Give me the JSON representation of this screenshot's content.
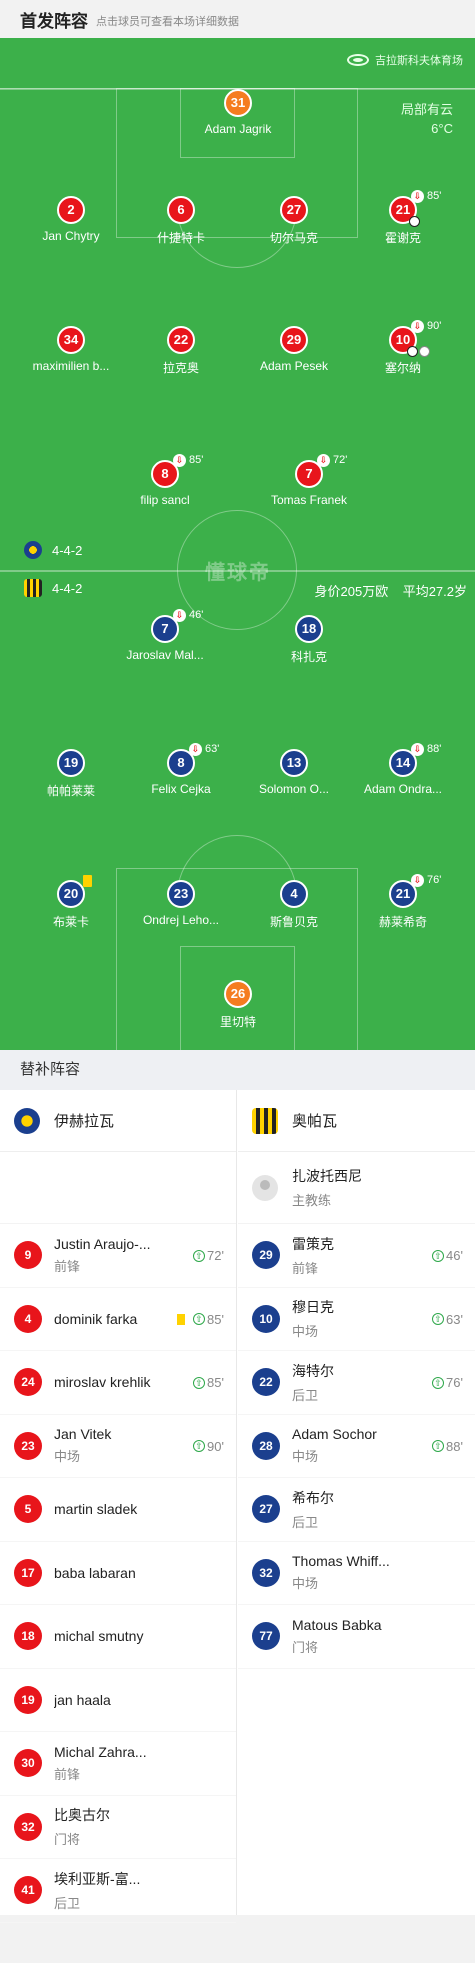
{
  "header": {
    "title": "首发阵容",
    "hint": "点击球员可查看本场详细数据"
  },
  "pitch": {
    "venue": "吉拉斯科夫体育场",
    "weather": "局部有云",
    "temperature": "6°C",
    "watermark": "懂球帝",
    "home_formation": "4-4-2",
    "away_formation": "4-4-2",
    "market_value": "身价205万欧",
    "avg_age": "平均27.2岁",
    "home_players": [
      {
        "num": "31",
        "name": "Adam Jagrik"
      },
      {
        "num": "2",
        "name": "Jan Chytry"
      },
      {
        "num": "6",
        "name": "什捷特卡"
      },
      {
        "num": "27",
        "name": "切尔马克"
      },
      {
        "num": "21",
        "name": "霍谢克",
        "sub": "85'"
      },
      {
        "num": "34",
        "name": "maximilien b..."
      },
      {
        "num": "22",
        "name": "拉克奥"
      },
      {
        "num": "29",
        "name": "Adam Pesek"
      },
      {
        "num": "10",
        "name": "塞尔纳",
        "sub": "90'"
      },
      {
        "num": "8",
        "name": "filip sancl",
        "sub": "85'"
      },
      {
        "num": "7",
        "name": "Tomas Franek",
        "sub": "72'"
      }
    ],
    "away_players": [
      {
        "num": "7",
        "name": "Jaroslav Mal...",
        "sub": "46'"
      },
      {
        "num": "18",
        "name": "科扎克"
      },
      {
        "num": "19",
        "name": "帕帕莱莱"
      },
      {
        "num": "8",
        "name": "Felix Cejka",
        "sub": "63'"
      },
      {
        "num": "13",
        "name": "Solomon O..."
      },
      {
        "num": "14",
        "name": "Adam Ondra...",
        "sub": "88'"
      },
      {
        "num": "20",
        "name": "布莱卡"
      },
      {
        "num": "23",
        "name": "Ondrej Leho..."
      },
      {
        "num": "4",
        "name": "斯鲁贝克"
      },
      {
        "num": "21",
        "name": "赫莱希奇",
        "sub": "76'"
      },
      {
        "num": "26",
        "name": "里切特"
      }
    ]
  },
  "subs": {
    "title": "替补阵容",
    "home_team": "伊赫拉瓦",
    "away_team": "奥帕瓦",
    "away_coach": {
      "name": "扎波托西尼",
      "role": "主教练"
    },
    "home": [
      {
        "num": "9",
        "name": "Justin Araujo-...",
        "pos": "前锋",
        "min": "72'"
      },
      {
        "num": "4",
        "name": "dominik farka",
        "pos": "",
        "min": "85'"
      },
      {
        "num": "24",
        "name": "miroslav krehlik",
        "pos": "",
        "min": "85'"
      },
      {
        "num": "23",
        "name": "Jan Vitek",
        "pos": "中场",
        "min": "90'"
      },
      {
        "num": "5",
        "name": "martin sladek",
        "pos": "",
        "min": ""
      },
      {
        "num": "17",
        "name": "baba labaran",
        "pos": "",
        "min": ""
      },
      {
        "num": "18",
        "name": "michal smutny",
        "pos": "",
        "min": ""
      },
      {
        "num": "19",
        "name": "jan haala",
        "pos": "",
        "min": ""
      },
      {
        "num": "30",
        "name": "Michal Zahra...",
        "pos": "前锋",
        "min": ""
      },
      {
        "num": "32",
        "name": "比奥古尔",
        "pos": "门将",
        "min": ""
      },
      {
        "num": "41",
        "name": "埃利亚斯-富...",
        "pos": "后卫",
        "min": ""
      }
    ],
    "away": [
      {
        "num": "29",
        "name": "雷策克",
        "pos": "前锋",
        "min": "46'"
      },
      {
        "num": "10",
        "name": "穆日克",
        "pos": "中场",
        "min": "63'"
      },
      {
        "num": "22",
        "name": "海特尔",
        "pos": "后卫",
        "min": "76'"
      },
      {
        "num": "28",
        "name": "Adam Sochor",
        "pos": "中场",
        "min": "88'"
      },
      {
        "num": "27",
        "name": "希布尔",
        "pos": "后卫",
        "min": ""
      },
      {
        "num": "32",
        "name": "Thomas Whiff...",
        "pos": "中场",
        "min": ""
      },
      {
        "num": "77",
        "name": "Matous Babka",
        "pos": "门将",
        "min": ""
      }
    ]
  }
}
